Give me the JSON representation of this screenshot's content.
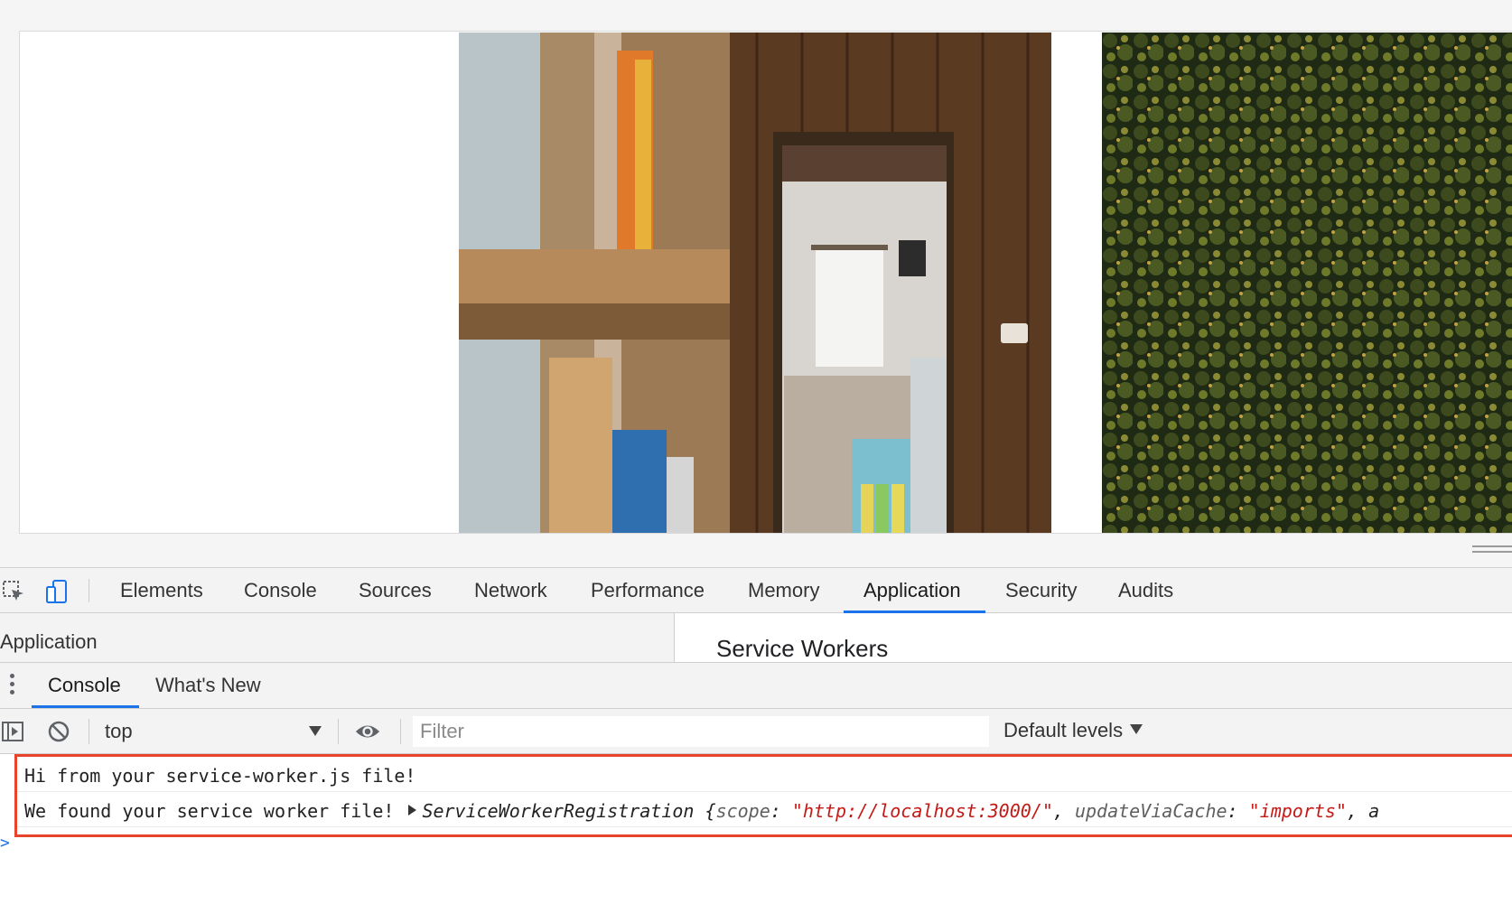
{
  "devtools": {
    "tabs": [
      {
        "label": "Elements"
      },
      {
        "label": "Console"
      },
      {
        "label": "Sources"
      },
      {
        "label": "Network"
      },
      {
        "label": "Performance"
      },
      {
        "label": "Memory"
      },
      {
        "label": "Application",
        "active": true
      },
      {
        "label": "Security"
      },
      {
        "label": "Audits"
      }
    ],
    "icons": {
      "inspect": "inspect-element-icon",
      "device": "device-toolbar-icon"
    },
    "accent_color": "#1a73e8"
  },
  "application": {
    "sidebar_title": "Application",
    "main_title": "Service Workers"
  },
  "drawer": {
    "tabs": [
      {
        "label": "Console",
        "active": true
      },
      {
        "label": "What's New"
      }
    ]
  },
  "console_toolbar": {
    "context": "top",
    "filter_placeholder": "Filter",
    "levels": "Default levels"
  },
  "console": {
    "messages": [
      {
        "text": "Hi from your service-worker.js file!"
      },
      {
        "prefix": "We found your service worker file! ",
        "object_name": "ServiceWorkerRegistration",
        "open_brace": " {",
        "k1": "scope",
        "sep": ": ",
        "v1": "\"http://localhost:3000/\"",
        "comma": ", ",
        "k2": "updateViaCache",
        "v2": "\"imports\"",
        "tail": ", a"
      }
    ],
    "highlight_color": "#e8442c",
    "prompt": ">"
  }
}
